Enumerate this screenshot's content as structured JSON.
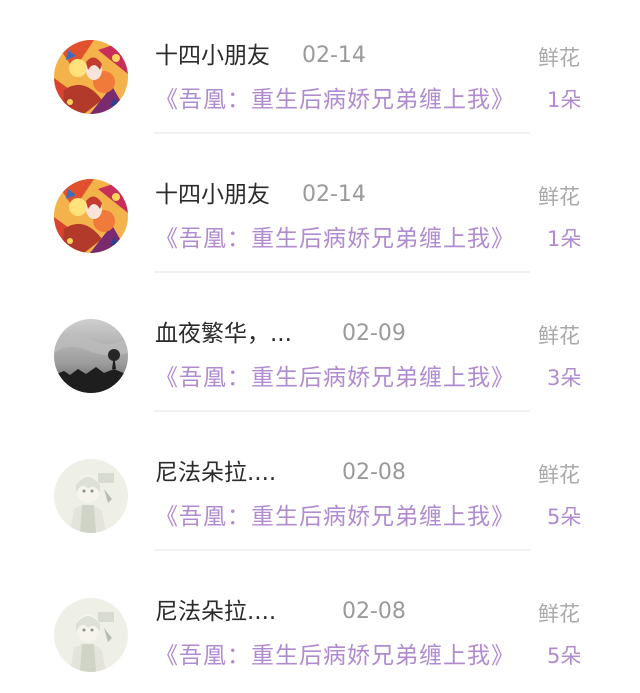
{
  "items": [
    {
      "name": "十四小朋友",
      "date": "02-14",
      "gift": "鲜花",
      "book": "《吾凰：重生后病娇兄弟缠上我》",
      "count": "1朵",
      "avatar": "colorful-anime-avatar-icon"
    },
    {
      "name": "十四小朋友",
      "date": "02-14",
      "gift": "鲜花",
      "book": "《吾凰：重生后病娇兄弟缠上我》",
      "count": "1朵",
      "avatar": "colorful-anime-avatar-icon"
    },
    {
      "name": "血夜繁华，...",
      "date": "02-09",
      "gift": "鲜花",
      "book": "《吾凰：重生后病娇兄弟缠上我》",
      "count": "3朵",
      "avatar": "grayscale-landscape-avatar-icon"
    },
    {
      "name": "尼法朵拉....",
      "date": "02-08",
      "gift": "鲜花",
      "book": "《吾凰：重生后病娇兄弟缠上我》",
      "count": "5朵",
      "avatar": "pale-anime-character-avatar-icon"
    },
    {
      "name": "尼法朵拉....",
      "date": "02-08",
      "gift": "鲜花",
      "book": "《吾凰：重生后病娇兄弟缠上我》",
      "count": "5朵",
      "avatar": "pale-anime-character-avatar-icon"
    }
  ],
  "colors": {
    "book_title": "#b08bd0",
    "name": "#2b2b2b",
    "date": "#9a9a9a",
    "gift": "#a9a9a9"
  }
}
